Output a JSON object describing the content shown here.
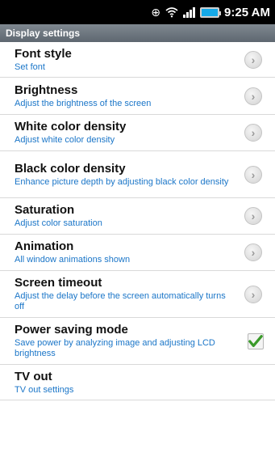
{
  "status_bar": {
    "time": "9:25 AM",
    "icons": [
      "gps-icon",
      "wifi-icon",
      "signal-icon",
      "battery-icon"
    ]
  },
  "header": {
    "title": "Display settings"
  },
  "settings": [
    {
      "title": "Font style",
      "subtitle": "Set font",
      "control": "chevron"
    },
    {
      "title": "Brightness",
      "subtitle": "Adjust the brightness of the screen",
      "control": "chevron"
    },
    {
      "title": "White color density",
      "subtitle": "Adjust white color density",
      "control": "chevron"
    },
    {
      "title": "Black color density",
      "subtitle": "Enhance picture depth by adjusting black color density",
      "control": "chevron"
    },
    {
      "title": "Saturation",
      "subtitle": "Adjust color saturation",
      "control": "chevron"
    },
    {
      "title": "Animation",
      "subtitle": "All window animations shown",
      "control": "chevron"
    },
    {
      "title": "Screen timeout",
      "subtitle": "Adjust the delay before the screen automatically turns off",
      "control": "chevron"
    },
    {
      "title": "Power saving mode",
      "subtitle": "Save power by analyzing image and adjusting LCD brightness",
      "control": "checkbox",
      "checked": true
    },
    {
      "title": "TV out",
      "subtitle": "TV out settings",
      "control": "none"
    }
  ],
  "colors": {
    "accent_subtitle": "#1b76c8",
    "check_green": "#3a9a2a",
    "battery": "#15a9e8"
  }
}
